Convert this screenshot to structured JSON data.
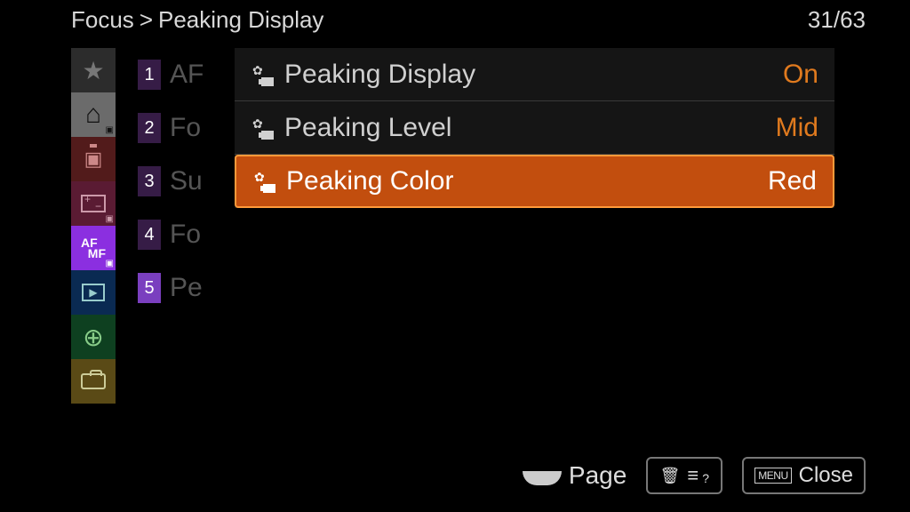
{
  "header": {
    "breadcrumb_root": "Focus",
    "breadcrumb_sep": ">",
    "breadcrumb_current": "Peaking Display",
    "page_current": "31",
    "page_sep": "/",
    "page_total": "63"
  },
  "rail": {
    "afmf_top": "AF",
    "afmf_bot": "MF"
  },
  "submenu": {
    "items": [
      {
        "num": "1",
        "label": "AF"
      },
      {
        "num": "2",
        "label": "Fo"
      },
      {
        "num": "3",
        "label": "Su"
      },
      {
        "num": "4",
        "label": "Fo"
      },
      {
        "num": "5",
        "label": "Pe"
      }
    ]
  },
  "panel": {
    "rows": [
      {
        "label": "Peaking Display",
        "value": "On"
      },
      {
        "label": "Peaking Level",
        "value": "Mid"
      },
      {
        "label": "Peaking Color",
        "value": "Red"
      }
    ]
  },
  "bottombar": {
    "page_label": "Page",
    "help_qmark": "?",
    "menu_label": "MENU",
    "close_label": "Close"
  }
}
